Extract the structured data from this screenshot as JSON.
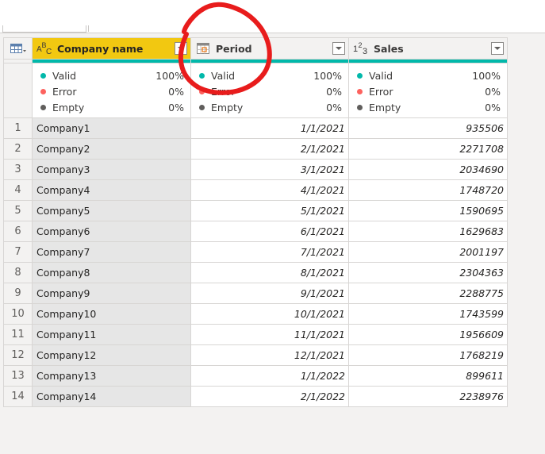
{
  "colors": {
    "selected_header": "#f2c811",
    "quality_bar": "#01b8aa",
    "valid": "#01b8aa",
    "error": "#fd625e",
    "empty": "#605e5c",
    "annotation": "#e81c1c"
  },
  "grid": {
    "corner_icon": "table-menu-icon",
    "columns": [
      {
        "name": "Company name",
        "type_icon": "text-type-icon",
        "type_glyph": "ABC",
        "selected": true,
        "quality": {
          "valid": "100%",
          "error": "0%",
          "empty": "0%"
        }
      },
      {
        "name": "Period",
        "type_icon": "date-type-icon",
        "type_glyph": "",
        "selected": false,
        "quality": {
          "valid": "100%",
          "error": "0%",
          "empty": "0%"
        }
      },
      {
        "name": "Sales",
        "type_icon": "whole-number-type-icon",
        "type_glyph": "123",
        "selected": false,
        "quality": {
          "valid": "100%",
          "error": "0%",
          "empty": "0%"
        }
      }
    ],
    "quality_labels": {
      "valid": "Valid",
      "error": "Error",
      "empty": "Empty"
    },
    "rows": [
      {
        "n": "1",
        "company": "Company1",
        "period": "1/1/2021",
        "sales": "935506"
      },
      {
        "n": "2",
        "company": "Company2",
        "period": "2/1/2021",
        "sales": "2271708"
      },
      {
        "n": "3",
        "company": "Company3",
        "period": "3/1/2021",
        "sales": "2034690"
      },
      {
        "n": "4",
        "company": "Company4",
        "period": "4/1/2021",
        "sales": "1748720"
      },
      {
        "n": "5",
        "company": "Company5",
        "period": "5/1/2021",
        "sales": "1590695"
      },
      {
        "n": "6",
        "company": "Company6",
        "period": "6/1/2021",
        "sales": "1629683"
      },
      {
        "n": "7",
        "company": "Company7",
        "period": "7/1/2021",
        "sales": "2001197"
      },
      {
        "n": "8",
        "company": "Company8",
        "period": "8/1/2021",
        "sales": "2304363"
      },
      {
        "n": "9",
        "company": "Company9",
        "period": "9/1/2021",
        "sales": "2288775"
      },
      {
        "n": "10",
        "company": "Company10",
        "period": "10/1/2021",
        "sales": "1743599"
      },
      {
        "n": "11",
        "company": "Company11",
        "period": "11/1/2021",
        "sales": "1956609"
      },
      {
        "n": "12",
        "company": "Company12",
        "period": "12/1/2021",
        "sales": "1768219"
      },
      {
        "n": "13",
        "company": "Company13",
        "period": "1/1/2022",
        "sales": "899611"
      },
      {
        "n": "14",
        "company": "Company14",
        "period": "2/1/2022",
        "sales": "2238976"
      }
    ]
  },
  "annotation": {
    "shape": "hand-drawn circle",
    "target": "Period column header"
  }
}
